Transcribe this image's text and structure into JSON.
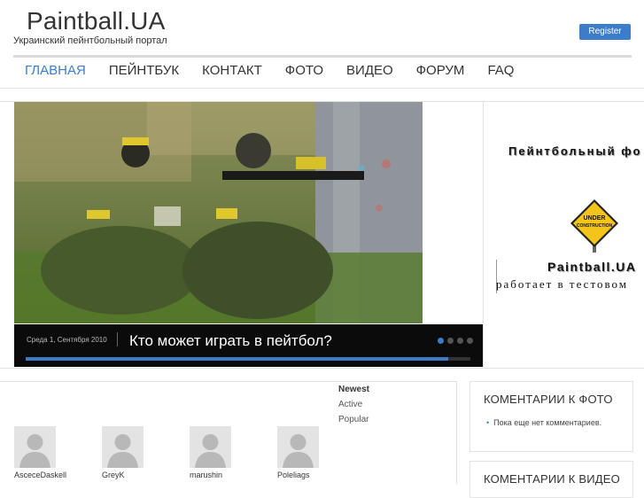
{
  "header": {
    "site_title": "Paintball.UA",
    "tagline": "Украинский пейнтбольный портал",
    "register_label": "Register"
  },
  "nav": {
    "items": [
      {
        "label": "ГЛАВНАЯ",
        "active": true
      },
      {
        "label": "ПЕЙНТБУК",
        "active": false
      },
      {
        "label": "КОНТАКТ",
        "active": false
      },
      {
        "label": "ФОТО",
        "active": false
      },
      {
        "label": "ВИДЕО",
        "active": false
      },
      {
        "label": "ФОРУМ",
        "active": false
      },
      {
        "label": "FAQ",
        "active": false
      }
    ]
  },
  "slider": {
    "date": "Среда 1, Сентября 2010",
    "title": "Кто может играть в пейтбол?",
    "slide_count": 4,
    "active_slide": 1,
    "progress": 0.95
  },
  "side_banner": {
    "line1": "Пейнтбольный фо",
    "sign_text": "UNDER CONSTRUCTION",
    "line2": "Paintball.UA",
    "line3": "работает в тестовом"
  },
  "members": {
    "filters": [
      {
        "label": "Newest",
        "selected": true
      },
      {
        "label": "Active",
        "selected": false
      },
      {
        "label": "Popular",
        "selected": false
      }
    ],
    "list": [
      {
        "name": "AsceceDaskell"
      },
      {
        "name": "GreyK"
      },
      {
        "name": "marushin"
      },
      {
        "name": "Poleliags"
      }
    ]
  },
  "widgets": {
    "photo_comments": {
      "title": "КОМЕНТАРИИ К ФОТО",
      "empty_text": "Пока еще нет комментариев."
    },
    "video_comments": {
      "title": "КОМЕНТАРИИ К ВИДЕО"
    }
  },
  "colors": {
    "accent": "#3d7cc9",
    "caption_bg": "#0b0b0b",
    "sign_yellow": "#f3c41a"
  }
}
